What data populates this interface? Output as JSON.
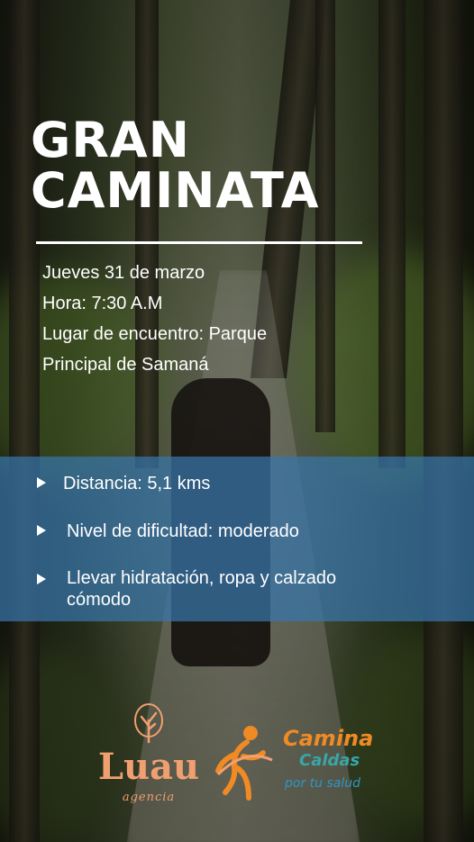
{
  "poster": {
    "title_line1": "GRAN",
    "title_line2": "CAMINATA",
    "info": {
      "date": "Jueves 31 de marzo",
      "time": "Hora: 7:30 A.M",
      "place_line1": "Lugar de encuentro: Parque",
      "place_line2": "Principal de Samaná"
    },
    "details": [
      {
        "line1": "Distancia: 5,1 kms",
        "line2": ""
      },
      {
        "line1": "Nivel de dificultad: moderado",
        "line2": ""
      },
      {
        "line1": "Llevar hidratación, ropa y calzado",
        "line2": "cómodo"
      }
    ],
    "logos": {
      "luau": {
        "name": "Luau",
        "sub": "agencia",
        "icon": "tree-icon"
      },
      "camina": {
        "name": "Camina",
        "region": "Caldas",
        "tagline": "por tu salud",
        "icon": "runner-icon"
      }
    }
  },
  "colors": {
    "band": "#3876aa",
    "text": "#ffffff",
    "luau_orange": "#f0a070",
    "camina_orange": "#f08a24",
    "caldas_teal": "#3aa6a8",
    "tagline_blue": "#2f95c8"
  }
}
